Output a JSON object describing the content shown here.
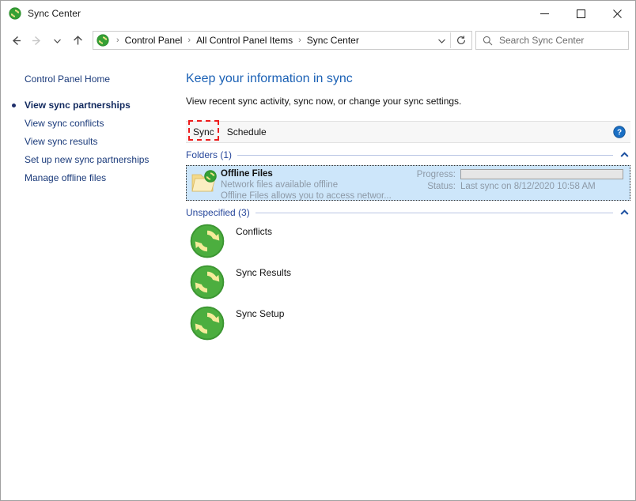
{
  "window": {
    "title": "Sync Center",
    "app_icon": "sync-icon",
    "controls": {
      "minimize": "minimize-icon",
      "maximize": "maximize-icon",
      "close": "close-icon"
    }
  },
  "nav": {
    "back": "back-arrow-icon",
    "forward": "forward-arrow-icon",
    "recent": "chevron-down-icon",
    "up": "up-arrow-icon",
    "breadcrumb": {
      "icon": "sync-icon",
      "items": [
        "Control Panel",
        "All Control Panel Items",
        "Sync Center"
      ],
      "separator": "›",
      "dropdown": "chevron-down-icon"
    },
    "refresh": "refresh-icon"
  },
  "search": {
    "icon": "search-icon",
    "placeholder": "Search Sync Center",
    "value": ""
  },
  "sidebar": {
    "home": "Control Panel Home",
    "items": [
      {
        "label": "View sync partnerships",
        "current": true
      },
      {
        "label": "View sync conflicts",
        "current": false
      },
      {
        "label": "View sync results",
        "current": false
      },
      {
        "label": "Set up new sync partnerships",
        "current": false
      },
      {
        "label": "Manage offline files",
        "current": false
      }
    ]
  },
  "main": {
    "title": "Keep your information in sync",
    "subtitle": "View recent sync activity, sync now, or change your sync settings.",
    "toolbar": {
      "sync_label": "Sync",
      "schedule_label": "Schedule",
      "help_icon": "help-icon",
      "annotated_button": "Sync"
    },
    "groups": [
      {
        "name": "folders",
        "title": "Folders (1)",
        "chevron": "chevron-up-icon"
      },
      {
        "name": "unspecified",
        "title": "Unspecified (3)",
        "chevron": "chevron-up-icon"
      }
    ],
    "folder_row": {
      "icon": "folder-sync-icon",
      "name": "Offline Files",
      "description": "Network files available offline",
      "detail": "Offline Files allows you to access networ...",
      "progress_label": "Progress:",
      "progress_percent": 0,
      "status_label": "Status:",
      "status_value": "Last sync on 8/12/2020 10:58 AM",
      "selected": true
    },
    "unspecified_items": [
      {
        "label": "Conflicts",
        "icon": "sync-icon"
      },
      {
        "label": "Sync Results",
        "icon": "sync-icon"
      },
      {
        "label": "Sync Setup",
        "icon": "sync-icon"
      }
    ]
  },
  "colors": {
    "accent_blue": "#1b61b5",
    "link_navy": "#1a3a7a",
    "group_blue": "#27479b",
    "selection_blue": "#cde6fa",
    "annotation_red": "#ee1c1c",
    "sync_green": "#3aa93a",
    "sync_yellow": "#f2e27a",
    "folder_yellow": "#f6dc92"
  }
}
